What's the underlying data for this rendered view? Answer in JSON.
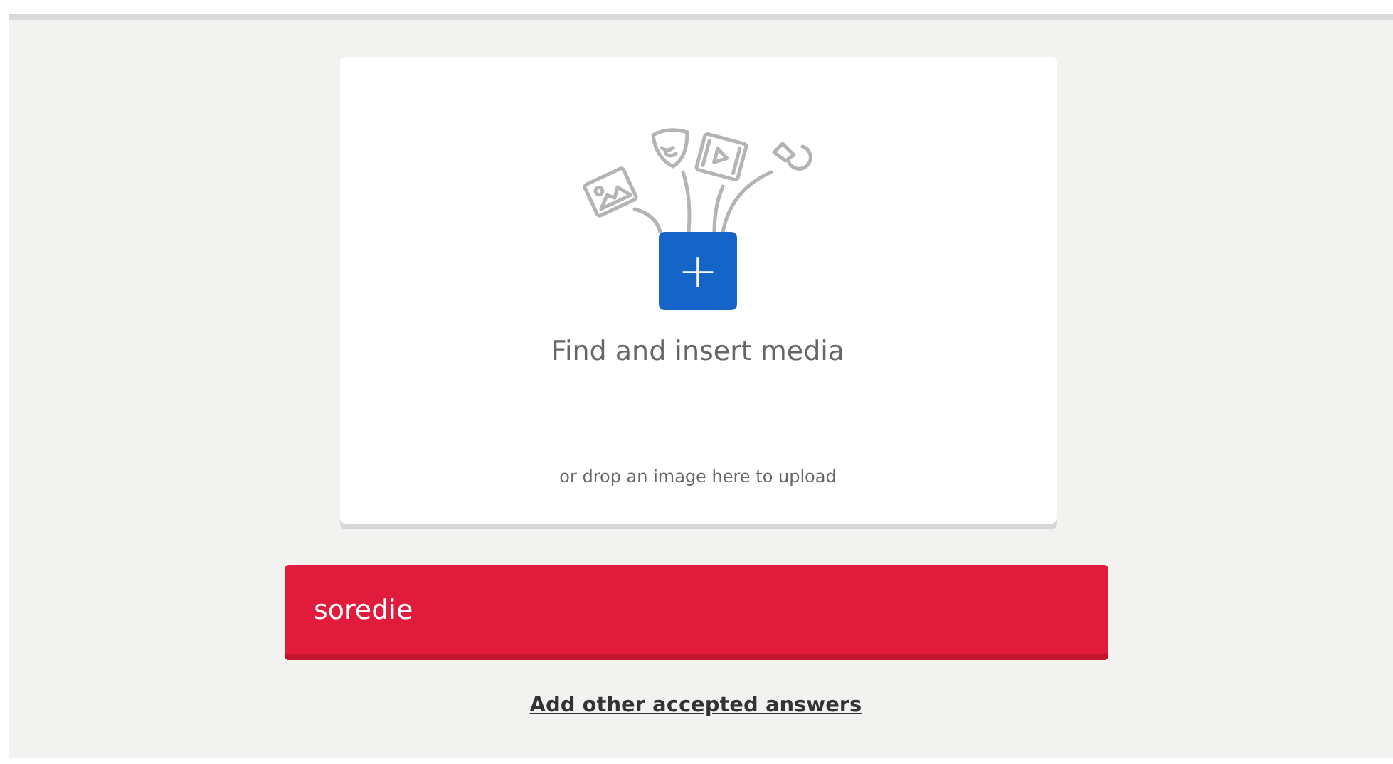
{
  "media_upload": {
    "title": "Find and insert media",
    "hint": "or drop an image here to upload",
    "add_button": "+"
  },
  "answer": {
    "value": "soredie"
  },
  "add_answers_link": "Add other accepted answers"
}
